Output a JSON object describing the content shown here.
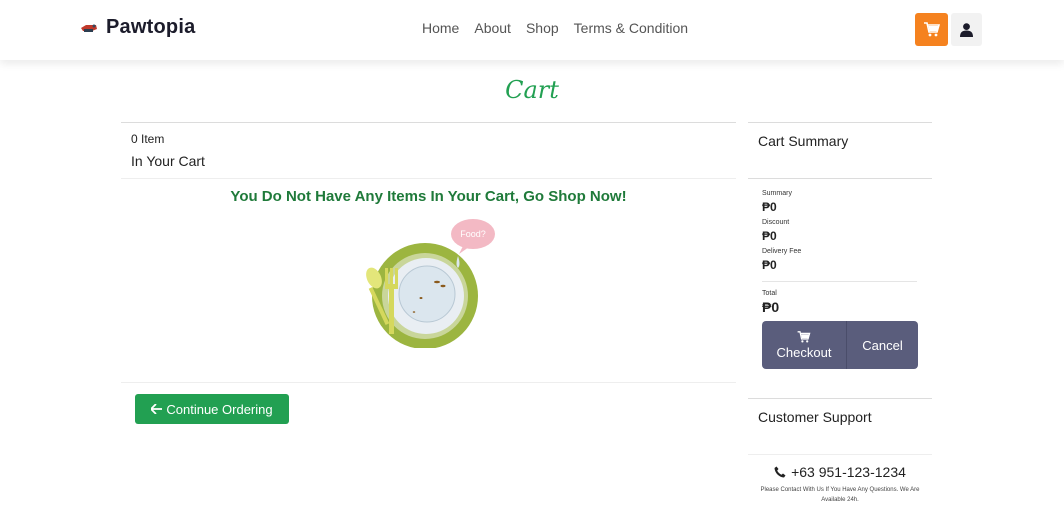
{
  "header": {
    "brand": "Pawtopia",
    "nav": [
      "Home",
      "About",
      "Shop",
      "Terms & Condition"
    ],
    "cart_icon": "cart-icon",
    "user_icon": "user-icon",
    "accent_color": "#f5821f"
  },
  "page": {
    "title": "Cart",
    "title_color": "#22a052"
  },
  "cart": {
    "item_count": "0 Item",
    "heading": "In Your Cart",
    "empty_message": "You Do Not Have Any Items In Your Cart, Go Shop Now!",
    "illustration_bubble": "Food?",
    "continue_label": "Continue Ordering"
  },
  "summary": {
    "title": "Cart Summary",
    "rows": [
      {
        "label": "Summary",
        "value": "₱0"
      },
      {
        "label": "Discount",
        "value": "₱0"
      },
      {
        "label": "Delivery Fee",
        "value": "₱0"
      }
    ],
    "total_label": "Total",
    "total_value": "₱0",
    "checkout_label": "Checkout",
    "cancel_label": "Cancel"
  },
  "support": {
    "title": "Customer Support",
    "phone": "+63 951-123-1234",
    "note": "Please Contact With Us If You Have Any Questions. We Are Available 24h."
  }
}
